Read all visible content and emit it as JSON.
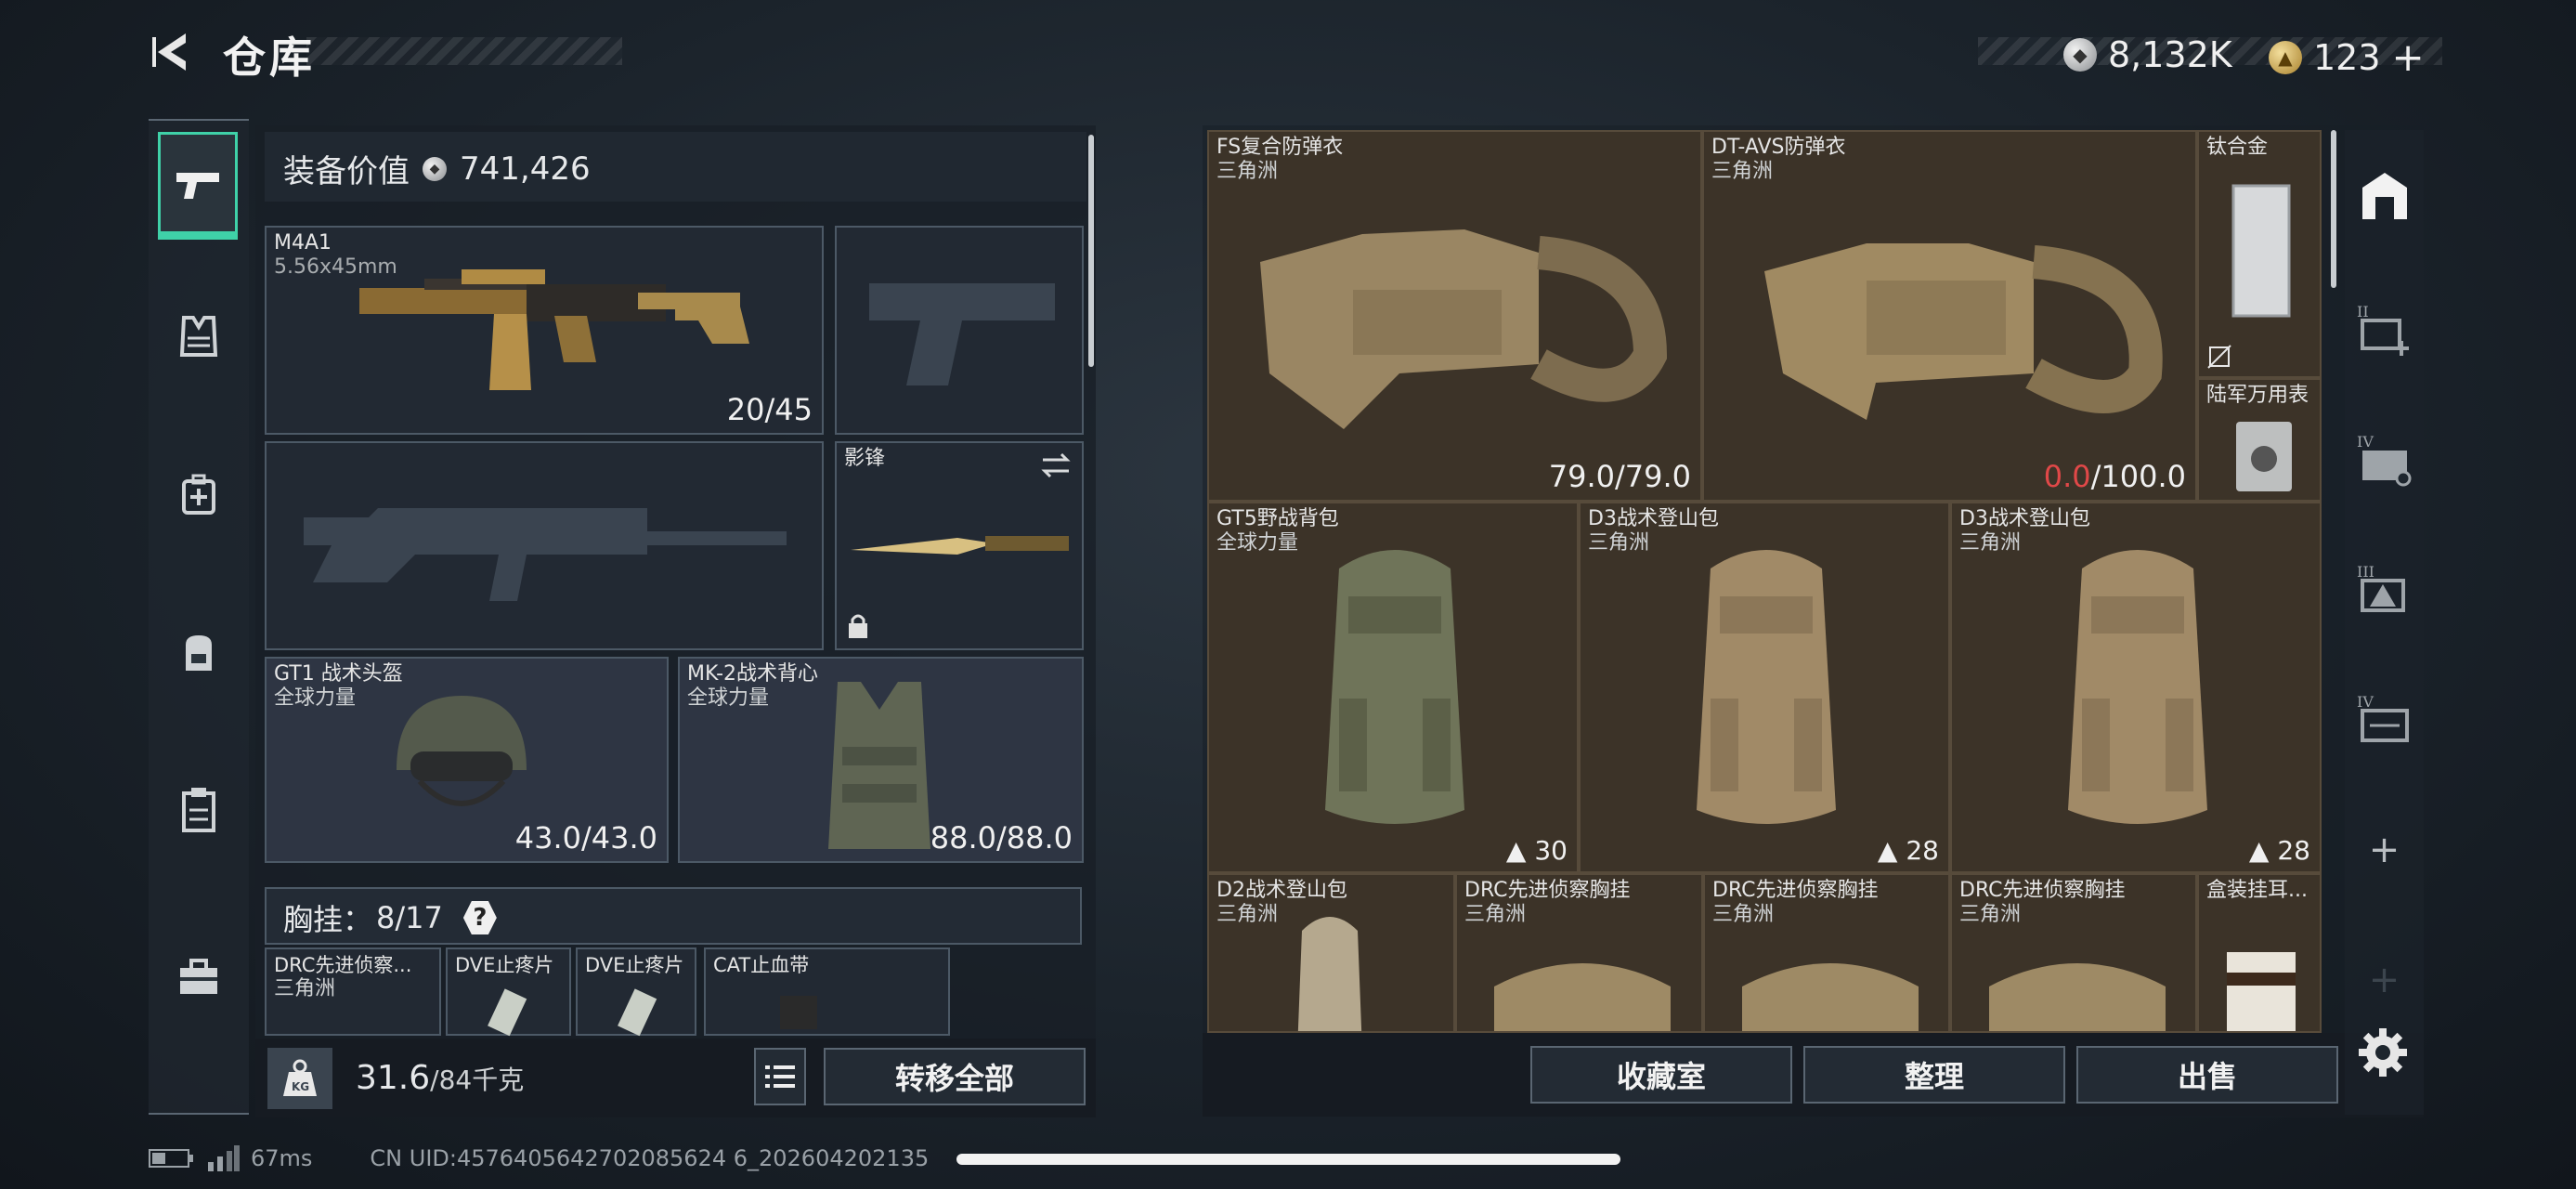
{
  "header": {
    "title": "仓库",
    "currency": [
      {
        "icon": "silver-coin-icon",
        "value": "8,132K"
      },
      {
        "icon": "gold-coin-icon",
        "value": "123"
      }
    ],
    "add_label": "+"
  },
  "left_nav": {
    "items": [
      {
        "name": "weapon",
        "icon": "pistol-icon",
        "active": true
      },
      {
        "name": "armor",
        "icon": "vest-icon"
      },
      {
        "name": "medical",
        "icon": "medkit-icon"
      },
      {
        "name": "backpack",
        "icon": "backpack-icon"
      },
      {
        "name": "clipboard",
        "icon": "clipboard-icon"
      },
      {
        "name": "toolbox",
        "icon": "toolbox-icon"
      }
    ]
  },
  "loadout": {
    "value_label": "装备价值",
    "value": "741,426",
    "primary_weapon": {
      "name": "M4A1",
      "ammo_type": "5.56x45mm",
      "ammo": "20/45"
    },
    "melee": {
      "name": "影锋"
    },
    "helmet": {
      "name": "GT1 战术头盔",
      "faction": "全球力量",
      "durability": "43.0/43.0"
    },
    "armor": {
      "name": "MK-2战术背心",
      "faction": "全球力量",
      "durability": "88.0/88.0"
    },
    "rig": {
      "label": "胸挂：",
      "capacity": "8/17",
      "help": "?"
    },
    "rig_items": [
      {
        "name": "DRC先进侦察...",
        "faction": "三角洲"
      },
      {
        "name": "DVE止疼片"
      },
      {
        "name": "DVE止疼片"
      },
      {
        "name": "CAT止血带"
      }
    ],
    "weight": {
      "current": "31.6",
      "max": "/84千克"
    },
    "transfer_all": "转移全部"
  },
  "storage": {
    "items": [
      {
        "name": "FS复合防弹衣",
        "faction": "三角洲",
        "durability": "79.0/79.0"
      },
      {
        "name": "DT-AVS防弹衣",
        "faction": "三角洲",
        "durability_current": "0.0",
        "durability_max": "/100.0"
      },
      {
        "name": "钛合金"
      },
      {
        "name": "陆军万用表"
      },
      {
        "name": "GT5野战背包",
        "faction": "全球力量",
        "capacity": "30"
      },
      {
        "name": "D3战术登山包",
        "faction": "三角洲",
        "capacity": "28"
      },
      {
        "name": "D3战术登山包",
        "faction": "三角洲",
        "capacity": "28"
      },
      {
        "name": "D2战术登山包",
        "faction": "三角洲"
      },
      {
        "name": "DRC先进侦察胸挂",
        "faction": "三角洲"
      },
      {
        "name": "DRC先进侦察胸挂",
        "faction": "三角洲"
      },
      {
        "name": "DRC先进侦察胸挂",
        "faction": "三角洲"
      },
      {
        "name": "盒装挂耳..."
      }
    ],
    "buttons": {
      "collection": "收藏室",
      "sort": "整理",
      "sell": "出售"
    }
  },
  "right_sidebar": {
    "icons": [
      "storage-icon",
      "tier-ii-add-icon",
      "tier-iv-folder-icon",
      "tier-iii-warning-icon",
      "tier-iv-folder-icon-2",
      "plus-icon",
      "plus-icon-faded",
      "settings-icon"
    ],
    "tier_labels": [
      "II",
      "IV",
      "III",
      "IV"
    ],
    "plus": "+"
  },
  "status_bar": {
    "ping": "67ms",
    "uid": "CN UID:4576405642702085624 6_202604202135"
  },
  "colors": {
    "accent": "#3fd1a8",
    "warning": "#e04848",
    "storage_cell": "#3c3328"
  }
}
